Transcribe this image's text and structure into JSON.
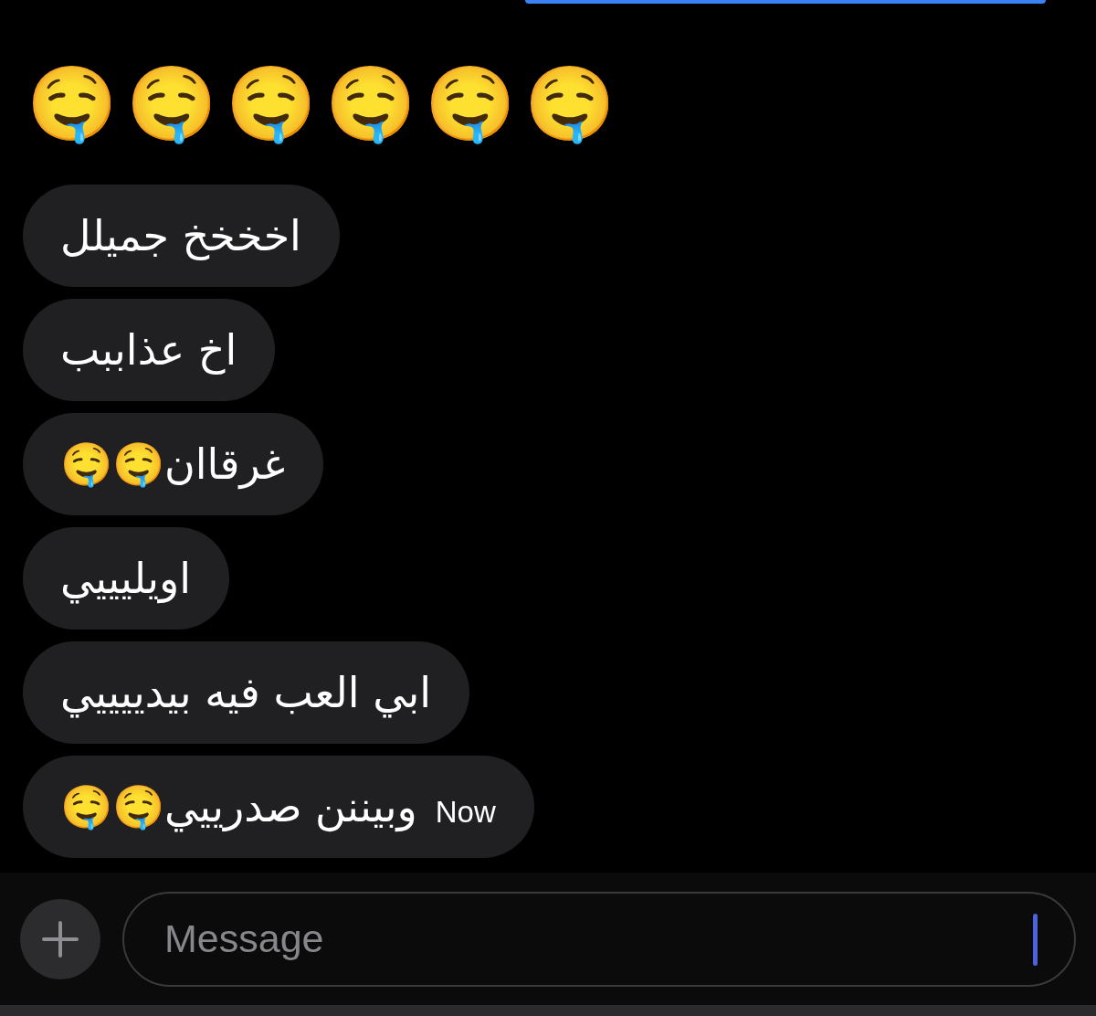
{
  "messages": [
    {
      "kind": "outgoing"
    },
    {
      "kind": "emoji_only",
      "text": "🤤🤤🤤🤤🤤🤤"
    },
    {
      "kind": "incoming",
      "text": "اخخخخ جميلل"
    },
    {
      "kind": "incoming",
      "text": "اخ عذاببب"
    },
    {
      "kind": "incoming",
      "text": "غرقاان🤤🤤"
    },
    {
      "kind": "incoming",
      "text": "اويليييي"
    },
    {
      "kind": "incoming",
      "text": "ابي العب فيه بيدييييي"
    },
    {
      "kind": "incoming",
      "text": "وبيننن صدرييي🤤🤤",
      "time": "Now"
    }
  ],
  "composer": {
    "placeholder": "Message",
    "focused": true
  }
}
